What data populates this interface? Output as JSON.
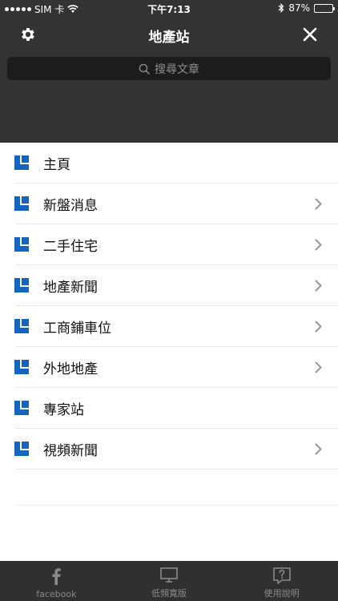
{
  "status_bar": {
    "carrier": "SIM 卡",
    "time": "下午7:13",
    "battery": "87%",
    "battery_level": 0.87
  },
  "header": {
    "title": "地產站",
    "settings_icon": "gear-icon",
    "close_icon": "close-icon"
  },
  "search": {
    "placeholder": "搜尋文章"
  },
  "menu": {
    "items": [
      {
        "label": "主頁",
        "has_chevron": false
      },
      {
        "label": "新盤消息",
        "has_chevron": true
      },
      {
        "label": "二手住宅",
        "has_chevron": true
      },
      {
        "label": "地產新聞",
        "has_chevron": true
      },
      {
        "label": "工商鋪車位",
        "has_chevron": true
      },
      {
        "label": "外地地產",
        "has_chevron": true
      },
      {
        "label": "專家站",
        "has_chevron": false
      },
      {
        "label": "視頻新聞",
        "has_chevron": true
      }
    ]
  },
  "bottom_bar": {
    "tabs": [
      {
        "label": "facebook",
        "icon": "facebook-icon"
      },
      {
        "label": "低頻寬版",
        "icon": "monitor-icon"
      },
      {
        "label": "使用說明",
        "icon": "help-icon"
      }
    ]
  },
  "colors": {
    "header_bg": "#333333",
    "accent_blue": "#1565c0",
    "bottom_bar_bg": "#303030"
  }
}
